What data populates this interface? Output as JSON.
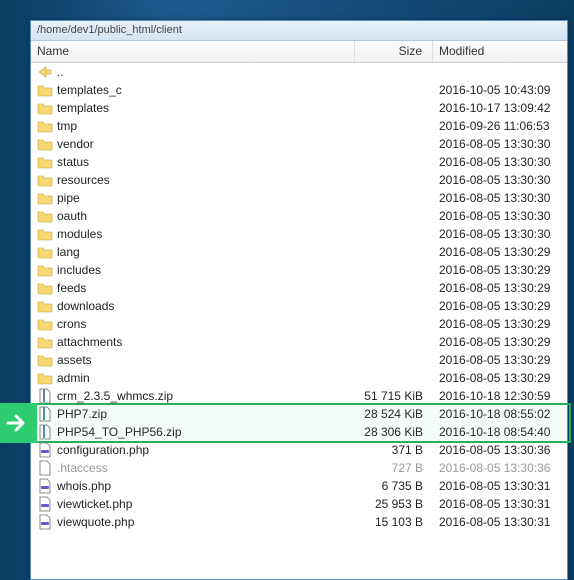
{
  "pathbar": "/home/dev1/public_html/client",
  "headers": {
    "name": "Name",
    "size": "Size",
    "modified": "Modified"
  },
  "callout": {
    "highlight_rows": [
      "PHP7.zip",
      "PHP54_TO_PHP56.zip"
    ]
  },
  "rows": [
    {
      "icon": "up",
      "name": "..",
      "size": "",
      "modified": ""
    },
    {
      "icon": "folder",
      "name": "templates_c",
      "size": "",
      "modified": "2016-10-05 10:43:09"
    },
    {
      "icon": "folder",
      "name": "templates",
      "size": "",
      "modified": "2016-10-17 13:09:42"
    },
    {
      "icon": "folder",
      "name": "tmp",
      "size": "",
      "modified": "2016-09-26 11:06:53"
    },
    {
      "icon": "folder",
      "name": "vendor",
      "size": "",
      "modified": "2016-08-05 13:30:30"
    },
    {
      "icon": "folder",
      "name": "status",
      "size": "",
      "modified": "2016-08-05 13:30:30"
    },
    {
      "icon": "folder",
      "name": "resources",
      "size": "",
      "modified": "2016-08-05 13:30:30"
    },
    {
      "icon": "folder",
      "name": "pipe",
      "size": "",
      "modified": "2016-08-05 13:30:30"
    },
    {
      "icon": "folder",
      "name": "oauth",
      "size": "",
      "modified": "2016-08-05 13:30:30"
    },
    {
      "icon": "folder",
      "name": "modules",
      "size": "",
      "modified": "2016-08-05 13:30:30"
    },
    {
      "icon": "folder",
      "name": "lang",
      "size": "",
      "modified": "2016-08-05 13:30:29"
    },
    {
      "icon": "folder",
      "name": "includes",
      "size": "",
      "modified": "2016-08-05 13:30:29"
    },
    {
      "icon": "folder",
      "name": "feeds",
      "size": "",
      "modified": "2016-08-05 13:30:29"
    },
    {
      "icon": "folder",
      "name": "downloads",
      "size": "",
      "modified": "2016-08-05 13:30:29"
    },
    {
      "icon": "folder",
      "name": "crons",
      "size": "",
      "modified": "2016-08-05 13:30:29"
    },
    {
      "icon": "folder",
      "name": "attachments",
      "size": "",
      "modified": "2016-08-05 13:30:29"
    },
    {
      "icon": "folder",
      "name": "assets",
      "size": "",
      "modified": "2016-08-05 13:30:29"
    },
    {
      "icon": "folder",
      "name": "admin",
      "size": "",
      "modified": "2016-08-05 13:30:29"
    },
    {
      "icon": "zip",
      "name": "crm_2.3.5_whmcs.zip",
      "size": "51 715 KiB",
      "modified": "2016-10-18 12:30:59"
    },
    {
      "icon": "zip",
      "name": "PHP7.zip",
      "size": "28 524 KiB",
      "modified": "2016-10-18 08:55:02",
      "hl": true
    },
    {
      "icon": "zip",
      "name": "PHP54_TO_PHP56.zip",
      "size": "28 306 KiB",
      "modified": "2016-10-18 08:54:40",
      "hl": true
    },
    {
      "icon": "php",
      "name": "configuration.php",
      "size": "371 B",
      "modified": "2016-08-05 13:30:36"
    },
    {
      "icon": "file",
      "name": ".htaccess",
      "size": "727 B",
      "modified": "2016-08-05 13:30:36",
      "dim": true
    },
    {
      "icon": "php",
      "name": "whois.php",
      "size": "6 735 B",
      "modified": "2016-08-05 13:30:31"
    },
    {
      "icon": "php",
      "name": "viewticket.php",
      "size": "25 953 B",
      "modified": "2016-08-05 13:30:31"
    },
    {
      "icon": "php",
      "name": "viewquote.php",
      "size": "15 103 B",
      "modified": "2016-08-05 13:30:31"
    }
  ]
}
